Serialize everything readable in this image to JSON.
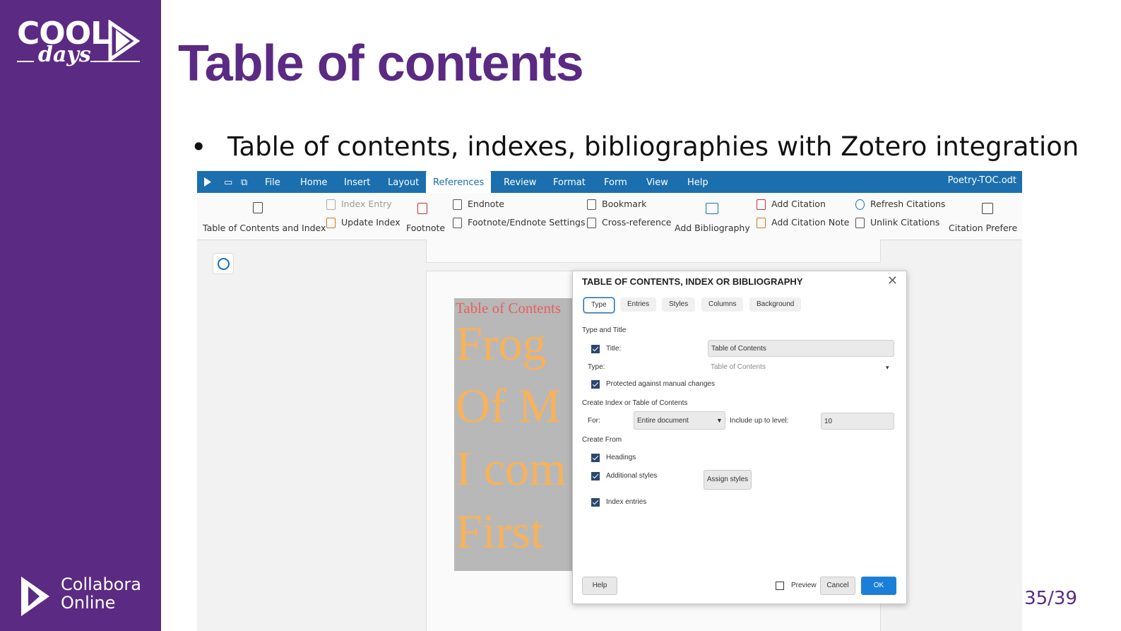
{
  "slide": {
    "title": "Table of contents",
    "bullet": "Table of contents, indexes, bibliographies with Zotero integration",
    "page_number": "35/39",
    "logo_top": {
      "word1": "COOL",
      "word2": "days"
    },
    "logo_bottom": {
      "line1": "Collabora",
      "line2": "Online"
    },
    "colors": {
      "brand_purple": "#5b2a83",
      "ribbon_blue": "#1b6fae"
    }
  },
  "app": {
    "document_name": "Poetry-TOC.odt",
    "tabs": [
      "File",
      "Home",
      "Insert",
      "Layout",
      "References",
      "Review",
      "Format",
      "Form",
      "View",
      "Help"
    ],
    "active_tab": "References",
    "ribbon": {
      "toc_index": "Table of Contents and Index",
      "index_entry": "Index Entry",
      "update_index": "Update Index",
      "footnote": "Footnote",
      "endnote": "Endnote",
      "footnote_settings": "Footnote/Endnote Settings",
      "bookmark": "Bookmark",
      "cross_reference": "Cross-reference",
      "add_bibliography": "Add Bibliography",
      "add_citation": "Add Citation",
      "add_citation_note": "Add Citation Note",
      "refresh_citations": "Refresh Citations",
      "unlink_citations": "Unlink Citations",
      "citation_preferences": "Citation Prefere"
    }
  },
  "document": {
    "toc_heading": "Table of Contents",
    "lines": [
      "Frog",
      "Of M",
      "I com",
      "First"
    ]
  },
  "dialog": {
    "title": "TABLE OF CONTENTS, INDEX OR BIBLIOGRAPHY",
    "tabs": [
      "Type",
      "Entries",
      "Styles",
      "Columns",
      "Background"
    ],
    "active_tab": "Type",
    "section_type_title": "Type and Title",
    "title_label": "Title:",
    "title_value": "Table of Contents",
    "type_label": "Type:",
    "type_value": "Table of Contents",
    "protected_label": "Protected against manual changes",
    "section_create_index": "Create Index or Table of Contents",
    "for_label": "For:",
    "for_value": "Entire document",
    "include_level_label": "Include up to level:",
    "include_level_value": "10",
    "section_create_from": "Create From",
    "headings_label": "Headings",
    "additional_styles_label": "Additional styles",
    "assign_styles_button": "Assign styles",
    "index_entries_label": "Index entries",
    "help_button": "Help",
    "preview_label": "Preview",
    "cancel_button": "Cancel",
    "ok_button": "OK",
    "checked": {
      "title": true,
      "protected": true,
      "headings": true,
      "additional_styles": true,
      "index_entries": true,
      "preview": false
    }
  }
}
